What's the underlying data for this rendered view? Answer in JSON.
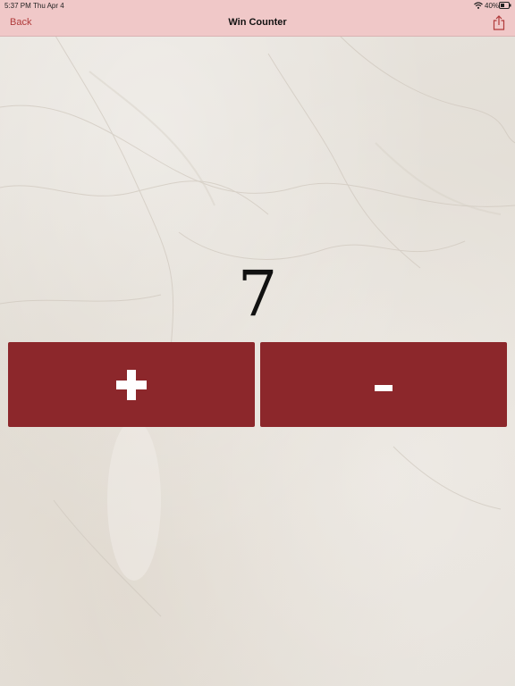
{
  "status_bar": {
    "time": "5:37 PM",
    "date": "Thu Apr 4",
    "battery": "40%"
  },
  "nav": {
    "back_label": "Back",
    "title": "Win Counter",
    "share_icon": "share-icon"
  },
  "counter": {
    "value": "7"
  },
  "buttons": {
    "increment_label": "+",
    "decrement_label": "-"
  },
  "colors": {
    "nav_background": "#f0c8c8",
    "accent_text": "#b03a3a",
    "button_background": "#8c272b",
    "button_glyph": "#ffffff",
    "background": "#e6e1da"
  }
}
